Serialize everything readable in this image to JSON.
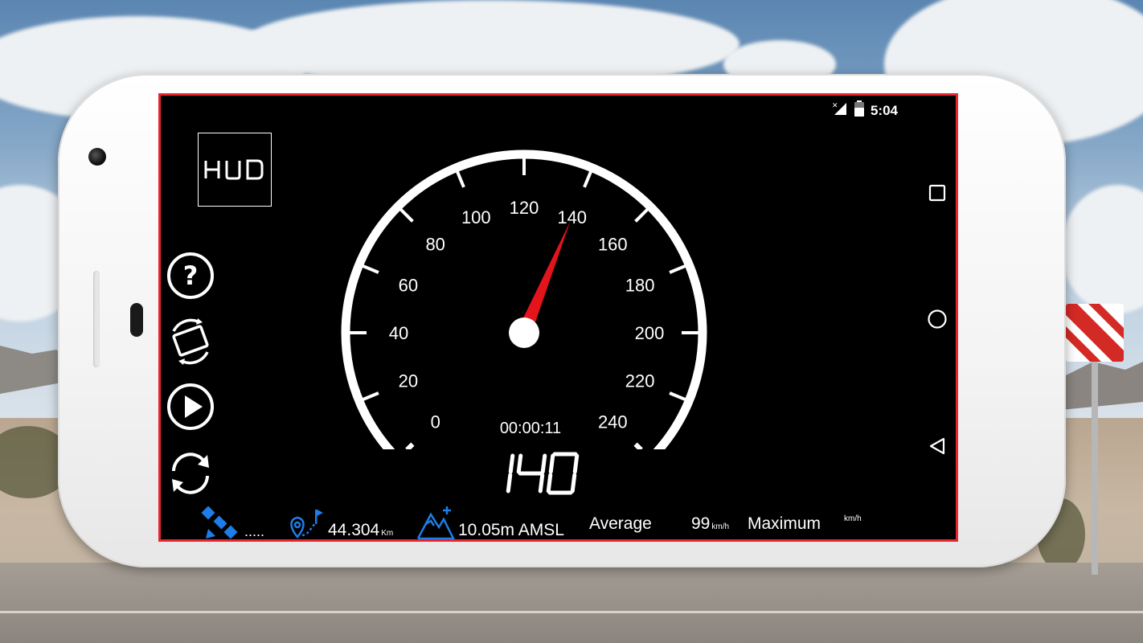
{
  "status_bar": {
    "time": "5:04",
    "signal_icon": "no-signal-icon",
    "battery_icon": "battery-icon"
  },
  "app": {
    "logo_text": "HUD",
    "side_buttons": [
      "help-icon",
      "rotate-screen-icon",
      "play-icon",
      "reset-icon"
    ],
    "accent_color": "#e8262f",
    "info_icon_color": "#1e7de6"
  },
  "speedometer": {
    "unit_labels": [
      "0",
      "20",
      "40",
      "60",
      "80",
      "100",
      "120",
      "140",
      "160",
      "180",
      "200",
      "220",
      "240"
    ],
    "min": 0,
    "max": 240,
    "needle_value": 140,
    "elapsed_time": "00:00:11",
    "digital_speed": "140"
  },
  "info_bar": {
    "gps_status": ".....",
    "distance_value": "44.304",
    "distance_unit": "Km",
    "altitude": "10.05m AMSL",
    "average_label": "Average",
    "average_value": "99",
    "average_unit": "km/h",
    "maximum_label": "Maximum",
    "maximum_value": "",
    "maximum_unit": "km/h"
  },
  "nav_bar": {
    "recents": "recents-icon",
    "home": "home-icon",
    "back": "back-icon"
  }
}
